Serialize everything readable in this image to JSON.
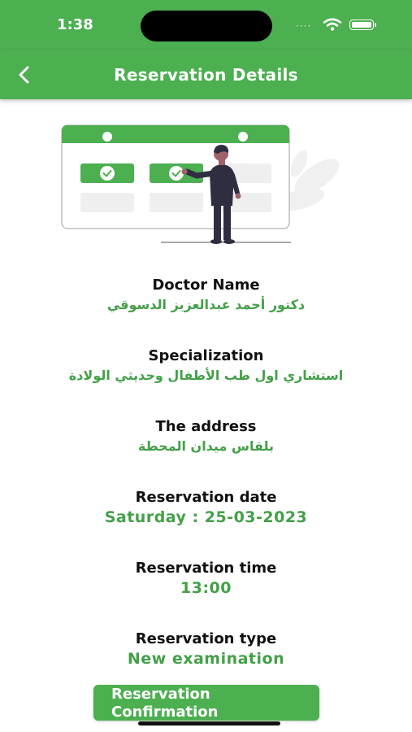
{
  "status_bar": {
    "time": "1:38",
    "dots": "····"
  },
  "app_bar": {
    "title": "Reservation Details"
  },
  "details": {
    "doctor_name_label": "Doctor Name",
    "doctor_name_value": "دكتور أحمد عبدالعزيز الدسوقي",
    "specialization_label": "Specialization",
    "specialization_value": "استشاري اول طب الأطفال وحديثي الولادة",
    "address_label": "The address",
    "address_value": "بلقاس ميدان المحطة",
    "date_label": "Reservation date",
    "date_value": "Saturday : 25-03-2023",
    "time_label": "Reservation time",
    "time_value": "13:00",
    "type_label": "Reservation type",
    "type_value": "New examination"
  },
  "confirm_button": {
    "label": "Reservation Confirmation"
  },
  "colors": {
    "primary": "#4caf50",
    "value_text": "#43a047",
    "label_text": "#111111"
  },
  "icons": {
    "back": "chevron-left-icon",
    "wifi": "wifi-icon",
    "battery": "battery-icon",
    "check": "check-icon"
  }
}
